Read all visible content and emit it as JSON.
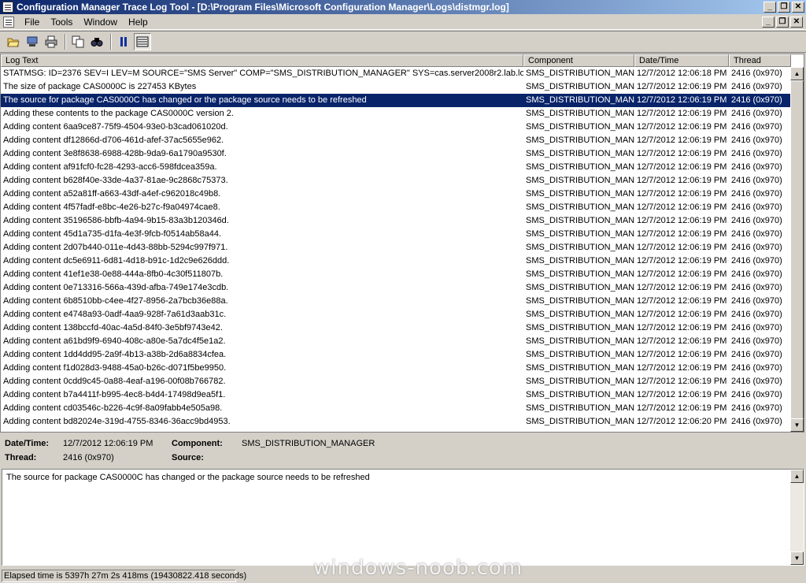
{
  "window": {
    "title": "Configuration Manager Trace Log Tool - [D:\\Program Files\\Microsoft Configuration Manager\\Logs\\distmgr.log]"
  },
  "menu": {
    "items": [
      "File",
      "Tools",
      "Window",
      "Help"
    ]
  },
  "toolbar": {
    "buttons": [
      {
        "name": "open-icon",
        "glyph": "📂"
      },
      {
        "name": "open-server-icon",
        "glyph": "🖥"
      },
      {
        "name": "print-icon",
        "glyph": "🖶"
      },
      {
        "name": "copy-icon",
        "glyph": "⧉"
      },
      {
        "name": "find-icon",
        "glyph": "🔍"
      },
      {
        "name": "pause-icon",
        "glyph": "⏸"
      },
      {
        "name": "view-icon",
        "glyph": "▤"
      }
    ]
  },
  "list": {
    "headers": [
      "Log Text",
      "Component",
      "Date/Time",
      "Thread"
    ],
    "rows": [
      [
        "STATMSG: ID=2376 SEV=I LEV=M SOURCE=\"SMS Server\" COMP=\"SMS_DISTRIBUTION_MANAGER\" SYS=cas.server2008r2.lab.lo...",
        "SMS_DISTRIBUTION_MAN",
        "12/7/2012 12:06:18 PM",
        "2416 (0x970)"
      ],
      [
        "The size of package CAS0000C is 227453 KBytes",
        "SMS_DISTRIBUTION_MAN",
        "12/7/2012 12:06:19 PM",
        "2416 (0x970)"
      ],
      [
        "The source for package CAS0000C has changed or the package source needs to be refreshed",
        "SMS_DISTRIBUTION_MAN",
        "12/7/2012 12:06:19 PM",
        "2416 (0x970)"
      ],
      [
        "Adding these contents to the package CAS0000C version 2.",
        "SMS_DISTRIBUTION_MAN",
        "12/7/2012 12:06:19 PM",
        "2416 (0x970)"
      ],
      [
        "Adding content 6aa9ce87-75f9-4504-93e0-b3cad061020d.",
        "SMS_DISTRIBUTION_MAN",
        "12/7/2012 12:06:19 PM",
        "2416 (0x970)"
      ],
      [
        "Adding content df12866d-d706-461d-afef-37ac5655e962.",
        "SMS_DISTRIBUTION_MAN",
        "12/7/2012 12:06:19 PM",
        "2416 (0x970)"
      ],
      [
        "Adding content 3e8f8638-6988-428b-9da9-6a1790a9530f.",
        "SMS_DISTRIBUTION_MAN",
        "12/7/2012 12:06:19 PM",
        "2416 (0x970)"
      ],
      [
        "Adding content af91fcf0-fc28-4293-acc6-598fdcea359a.",
        "SMS_DISTRIBUTION_MAN",
        "12/7/2012 12:06:19 PM",
        "2416 (0x970)"
      ],
      [
        "Adding content b628f40e-33de-4a37-81ae-9c2868c75373.",
        "SMS_DISTRIBUTION_MAN",
        "12/7/2012 12:06:19 PM",
        "2416 (0x970)"
      ],
      [
        "Adding content a52a81ff-a663-43df-a4ef-c962018c49b8.",
        "SMS_DISTRIBUTION_MAN",
        "12/7/2012 12:06:19 PM",
        "2416 (0x970)"
      ],
      [
        "Adding content 4f57fadf-e8bc-4e26-b27c-f9a04974cae8.",
        "SMS_DISTRIBUTION_MAN",
        "12/7/2012 12:06:19 PM",
        "2416 (0x970)"
      ],
      [
        "Adding content 35196586-bbfb-4a94-9b15-83a3b120346d.",
        "SMS_DISTRIBUTION_MAN",
        "12/7/2012 12:06:19 PM",
        "2416 (0x970)"
      ],
      [
        "Adding content 45d1a735-d1fa-4e3f-9fcb-f0514ab58a44.",
        "SMS_DISTRIBUTION_MAN",
        "12/7/2012 12:06:19 PM",
        "2416 (0x970)"
      ],
      [
        "Adding content 2d07b440-011e-4d43-88bb-5294c997f971.",
        "SMS_DISTRIBUTION_MAN",
        "12/7/2012 12:06:19 PM",
        "2416 (0x970)"
      ],
      [
        "Adding content dc5e6911-6d81-4d18-b91c-1d2c9e626ddd.",
        "SMS_DISTRIBUTION_MAN",
        "12/7/2012 12:06:19 PM",
        "2416 (0x970)"
      ],
      [
        "Adding content 41ef1e38-0e88-444a-8fb0-4c30f511807b.",
        "SMS_DISTRIBUTION_MAN",
        "12/7/2012 12:06:19 PM",
        "2416 (0x970)"
      ],
      [
        "Adding content 0e713316-566a-439d-afba-749e174e3cdb.",
        "SMS_DISTRIBUTION_MAN",
        "12/7/2012 12:06:19 PM",
        "2416 (0x970)"
      ],
      [
        "Adding content 6b8510bb-c4ee-4f27-8956-2a7bcb36e88a.",
        "SMS_DISTRIBUTION_MAN",
        "12/7/2012 12:06:19 PM",
        "2416 (0x970)"
      ],
      [
        "Adding content e4748a93-0adf-4aa9-928f-7a61d3aab31c.",
        "SMS_DISTRIBUTION_MAN",
        "12/7/2012 12:06:19 PM",
        "2416 (0x970)"
      ],
      [
        "Adding content 138bccfd-40ac-4a5d-84f0-3e5bf9743e42.",
        "SMS_DISTRIBUTION_MAN",
        "12/7/2012 12:06:19 PM",
        "2416 (0x970)"
      ],
      [
        "Adding content a61bd9f9-6940-408c-a80e-5a7dc4f5e1a2.",
        "SMS_DISTRIBUTION_MAN",
        "12/7/2012 12:06:19 PM",
        "2416 (0x970)"
      ],
      [
        "Adding content 1dd4dd95-2a9f-4b13-a38b-2d6a8834cfea.",
        "SMS_DISTRIBUTION_MAN",
        "12/7/2012 12:06:19 PM",
        "2416 (0x970)"
      ],
      [
        "Adding content f1d028d3-9488-45a0-b26c-d071f5be9950.",
        "SMS_DISTRIBUTION_MAN",
        "12/7/2012 12:06:19 PM",
        "2416 (0x970)"
      ],
      [
        "Adding content 0cdd9c45-0a88-4eaf-a196-00f08b766782.",
        "SMS_DISTRIBUTION_MAN",
        "12/7/2012 12:06:19 PM",
        "2416 (0x970)"
      ],
      [
        "Adding content b7a4411f-b995-4ec8-b4d4-17498d9ea5f1.",
        "SMS_DISTRIBUTION_MAN",
        "12/7/2012 12:06:19 PM",
        "2416 (0x970)"
      ],
      [
        "Adding content cd03546c-b226-4c9f-8a09fabb4e505a98.",
        "SMS_DISTRIBUTION_MAN",
        "12/7/2012 12:06:19 PM",
        "2416 (0x970)"
      ],
      [
        "Adding content bd82024e-319d-4755-8346-36acc9bd4953.",
        "SMS_DISTRIBUTION_MAN",
        "12/7/2012 12:06:20 PM",
        "2416 (0x970)"
      ]
    ],
    "selected_row": 2
  },
  "details": {
    "datetime_label": "Date/Time:",
    "datetime_value": "12/7/2012 12:06:19 PM",
    "component_label": "Component:",
    "component_value": "SMS_DISTRIBUTION_MANAGER",
    "thread_label": "Thread:",
    "thread_value": "2416 (0x970)",
    "source_label": "Source:",
    "source_value": "",
    "message": "The source for package CAS0000C has changed or the package source needs to be refreshed"
  },
  "status": {
    "text": "Elapsed time is 5397h 27m 2s 418ms (19430822.418 seconds)"
  },
  "watermark": "windows-noob.com"
}
